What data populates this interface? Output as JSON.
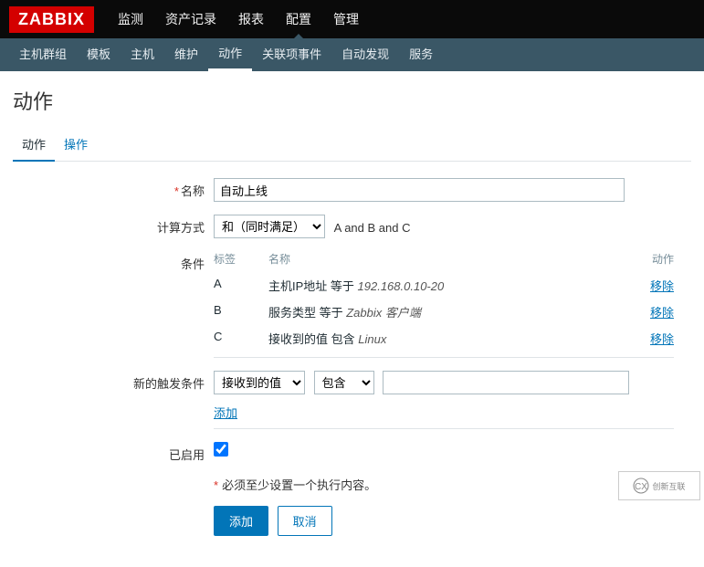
{
  "logo": "ZABBIX",
  "topnav": {
    "items": [
      "监测",
      "资产记录",
      "报表",
      "配置",
      "管理"
    ],
    "active_index": 3
  },
  "subnav": {
    "items": [
      "主机群组",
      "模板",
      "主机",
      "维护",
      "动作",
      "关联项事件",
      "自动发现",
      "服务"
    ],
    "active_index": 4
  },
  "page_title": "动作",
  "tabs": {
    "items": [
      "动作",
      "操作"
    ],
    "active_index": 0
  },
  "form": {
    "name_label": "名称",
    "name_value": "自动上线",
    "calc_label": "计算方式",
    "calc_options": [
      "和（同时满足）"
    ],
    "calc_expr": "A and B and C",
    "conditions_label": "条件",
    "cond_header_label": "标签",
    "cond_header_name": "名称",
    "cond_header_action": "动作",
    "conditions": [
      {
        "label": "A",
        "text_prefix": "主机IP地址 等于 ",
        "text_em": "192.168.0.10-20",
        "remove": "移除"
      },
      {
        "label": "B",
        "text_prefix": "服务类型 等于 ",
        "text_em": "Zabbix 客户端",
        "remove": "移除"
      },
      {
        "label": "C",
        "text_prefix": "接收到的值 包含 ",
        "text_em": "Linux",
        "remove": "移除"
      }
    ],
    "new_trigger_label": "新的触发条件",
    "new_trigger_type_options": [
      "接收到的值"
    ],
    "new_trigger_op_options": [
      "包含"
    ],
    "new_trigger_value": "",
    "add_link": "添加",
    "enabled_label": "已启用",
    "enabled_value": true,
    "warn_text": "必须至少设置一个执行内容。",
    "submit_label": "添加",
    "cancel_label": "取消"
  },
  "watermark": "创新互联"
}
